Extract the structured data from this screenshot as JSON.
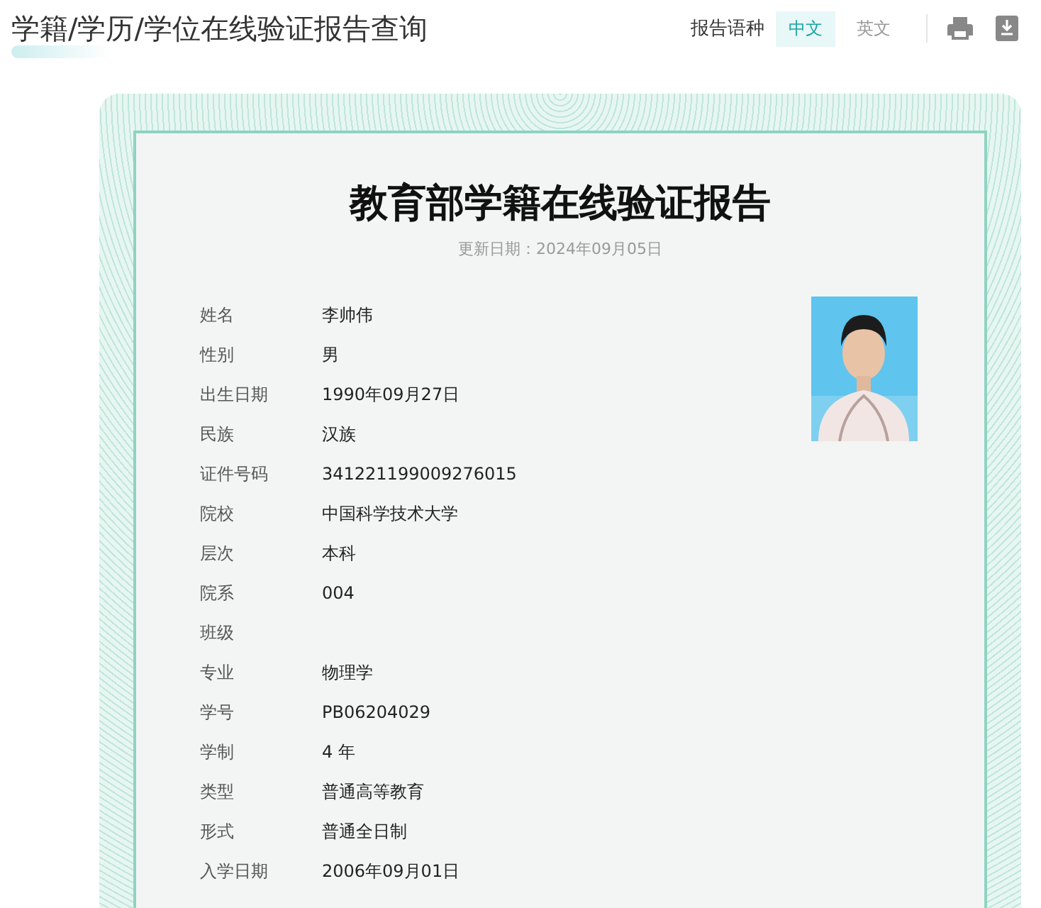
{
  "header": {
    "title": "学籍/学历/学位在线验证报告查询",
    "language_label": "报告语种",
    "languages": [
      {
        "label": "中文",
        "selected": true
      },
      {
        "label": "英文",
        "selected": false
      }
    ]
  },
  "report": {
    "title": "教育部学籍在线验证报告",
    "updated": "更新日期：2024年09月05日",
    "fields": [
      {
        "label": "姓名",
        "value": "李帅伟"
      },
      {
        "label": "性别",
        "value": "男"
      },
      {
        "label": "出生日期",
        "value": "1990年09月27日"
      },
      {
        "label": "民族",
        "value": "汉族"
      },
      {
        "label": "证件号码",
        "value": "341221199009276015"
      },
      {
        "label": "院校",
        "value": "中国科学技术大学"
      },
      {
        "label": "层次",
        "value": "本科"
      },
      {
        "label": "院系",
        "value": "004"
      },
      {
        "label": "班级"
      },
      {
        "label": "专业",
        "value": "物理学"
      },
      {
        "label": "学号",
        "value": "PB06204029"
      },
      {
        "label": "学制",
        "value": "4 年"
      },
      {
        "label": "类型",
        "value": "普通高等教育"
      },
      {
        "label": "形式",
        "value": "普通全日制"
      },
      {
        "label": "入学日期",
        "value": "2006年09月01日"
      }
    ]
  }
}
